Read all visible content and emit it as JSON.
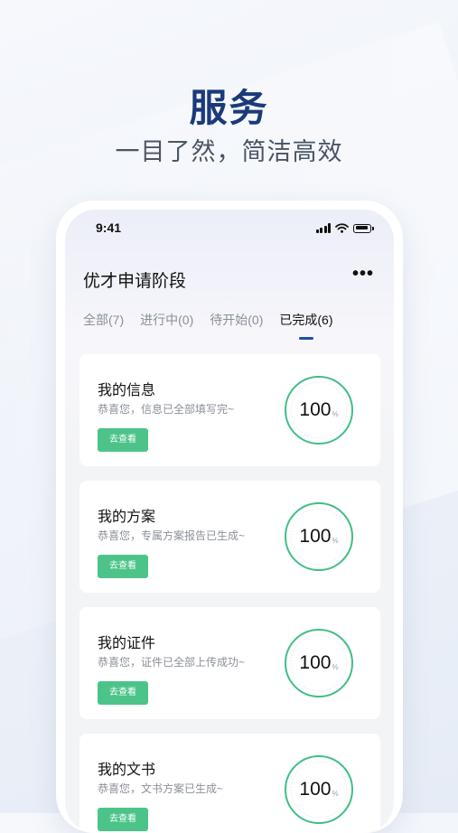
{
  "hero": {
    "title": "服务",
    "subtitle": "一目了然，简洁高效"
  },
  "status_bar": {
    "time": "9:41"
  },
  "header": {
    "title": "优才申请阶段",
    "more_icon": "more-horizontal-icon"
  },
  "tabs": [
    {
      "label": "全部(7)",
      "active": false
    },
    {
      "label": "进行中(0)",
      "active": false
    },
    {
      "label": "待开始(0)",
      "active": false
    },
    {
      "label": "已完成(6)",
      "active": true
    }
  ],
  "cards": [
    {
      "title": "我的信息",
      "desc": "恭喜您，信息已全部填写完~",
      "button": "去查看",
      "progress": "100",
      "unit": "%"
    },
    {
      "title": "我的方案",
      "desc": "恭喜您，专属方案报告已生成~",
      "button": "去查看",
      "progress": "100",
      "unit": "%"
    },
    {
      "title": "我的证件",
      "desc": "恭喜您，证件已全部上传成功~",
      "button": "去查看",
      "progress": "100",
      "unit": "%"
    },
    {
      "title": "我的文书",
      "desc": "恭喜您，文书方案已生成~",
      "button": "去查看",
      "progress": "100",
      "unit": "%"
    }
  ],
  "colors": {
    "accent_blue": "#1e4fa8",
    "hero_title": "#1b3a7a",
    "button_green": "#4cc489",
    "ring_green": "#3fbf86"
  }
}
